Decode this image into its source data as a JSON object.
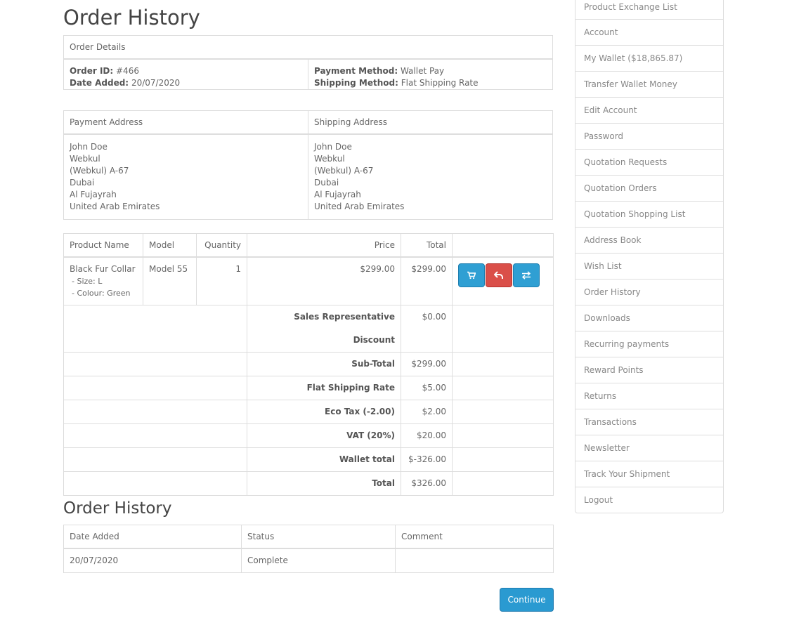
{
  "page": {
    "title": "Order History"
  },
  "order_details": {
    "heading": "Order Details",
    "order_id_label": "Order ID:",
    "order_id": "#466",
    "date_added_label": "Date Added:",
    "date_added": "20/07/2020",
    "payment_method_label": "Payment Method:",
    "payment_method": "Wallet Pay",
    "shipping_method_label": "Shipping Method:",
    "shipping_method": "Flat Shipping Rate"
  },
  "addresses": {
    "payment_heading": "Payment Address",
    "shipping_heading": "Shipping Address",
    "payment_lines": [
      "John Doe",
      "Webkul",
      "(Webkul) A-67",
      "Dubai",
      "Al Fujayrah",
      "United Arab Emirates"
    ],
    "shipping_lines": [
      "John Doe",
      "Webkul",
      "(Webkul) A-67",
      "Dubai",
      "Al Fujayrah",
      "United Arab Emirates"
    ]
  },
  "products": {
    "columns": {
      "name": "Product Name",
      "model": "Model",
      "quantity": "Quantity",
      "price": "Price",
      "total": "Total"
    },
    "item": {
      "name": "Black Fur Collar",
      "option_size": "- Size: L",
      "option_colour": "- Colour: Green",
      "model": "Model 55",
      "quantity": "1",
      "price": "$299.00",
      "total": "$299.00"
    },
    "actions": {
      "reorder_icon": "cart-icon",
      "return_icon": "reply-icon",
      "exchange_icon": "exchange-icon"
    },
    "totals": [
      {
        "label": "Sales Representative Discount",
        "value": "$0.00"
      },
      {
        "label": "Sub-Total",
        "value": "$299.00"
      },
      {
        "label": "Flat Shipping Rate",
        "value": "$5.00"
      },
      {
        "label": "Eco Tax (-2.00)",
        "value": "$2.00"
      },
      {
        "label": "VAT (20%)",
        "value": "$20.00"
      },
      {
        "label": "Wallet total",
        "value": "$-326.00"
      },
      {
        "label": "Total",
        "value": "$326.00"
      }
    ]
  },
  "history": {
    "title": "Order History",
    "columns": {
      "date": "Date Added",
      "status": "Status",
      "comment": "Comment"
    },
    "row": {
      "date": "20/07/2020",
      "status": "Complete",
      "comment": ""
    }
  },
  "continue_label": "Continue",
  "colors": {
    "primary": "#2f9fd3",
    "danger": "#da4f49"
  },
  "sidebar": {
    "items": [
      "Product Exchange List",
      "Account",
      "My Wallet ($18,865.87)",
      "Transfer Wallet Money",
      "Edit Account",
      "Password",
      "Quotation Requests",
      "Quotation Orders",
      "Quotation Shopping List",
      "Address Book",
      "Wish List",
      "Order History",
      "Downloads",
      "Recurring payments",
      "Reward Points",
      "Returns",
      "Transactions",
      "Newsletter",
      "Track Your Shipment",
      "Logout"
    ]
  }
}
